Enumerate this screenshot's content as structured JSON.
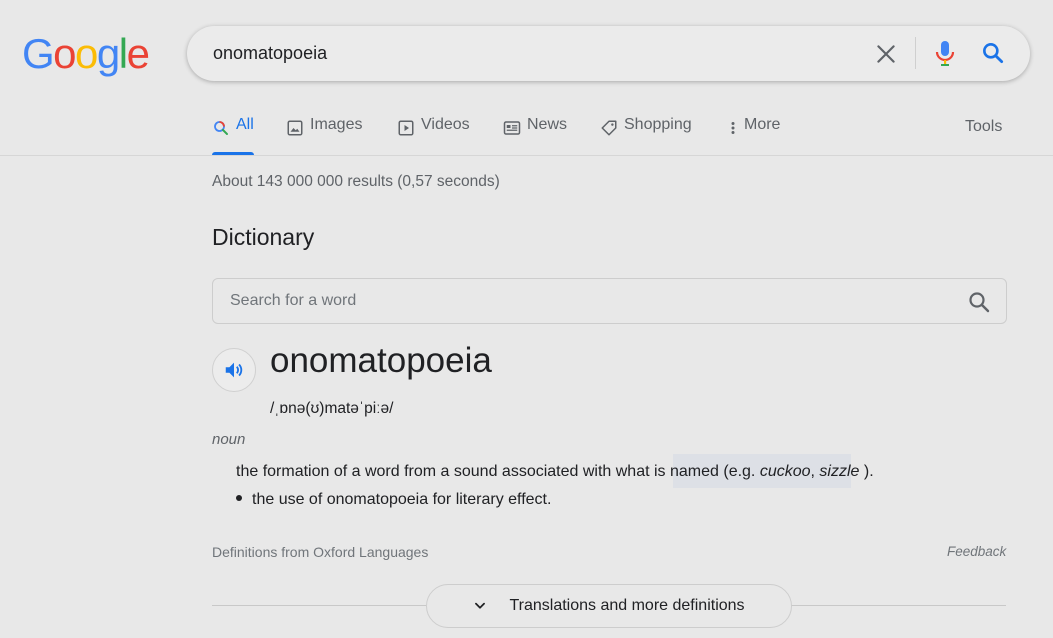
{
  "logo": {
    "letters": [
      "G",
      "o",
      "o",
      "g",
      "l",
      "e"
    ],
    "colors": [
      "#4285f4",
      "#ea4335",
      "#fbbc05",
      "#4285f4",
      "#34a853",
      "#ea4335"
    ]
  },
  "search": {
    "query": "onomatopoeia"
  },
  "tabs": [
    {
      "label": "All",
      "icon": "search-icon",
      "active": true
    },
    {
      "label": "Images",
      "icon": "image-icon"
    },
    {
      "label": "Videos",
      "icon": "play-icon"
    },
    {
      "label": "News",
      "icon": "newspaper-icon"
    },
    {
      "label": "Shopping",
      "icon": "tag-icon"
    },
    {
      "label": "More",
      "icon": "more-vert-icon"
    }
  ],
  "tools_label": "Tools",
  "result_stats": "About 143 000 000 results (0,57 seconds)",
  "dictionary": {
    "title": "Dictionary",
    "search_placeholder": "Search for a word",
    "headword": "onomatopoeia",
    "phonetic": "/ˌɒnə(ʊ)matəˈpiːə/",
    "part_of_speech": "noun",
    "definition_main_prefix": "the formation of a word from a sound associated with what is named (e.g. ",
    "example1": "cuckoo",
    "sep": ", ",
    "example2": "sizzle",
    "definition_main_suffix": " ).",
    "definition_sub": "the use of onomatopoeia for literary effect.",
    "source": "Definitions from Oxford Languages",
    "feedback": "Feedback",
    "more_button": "Translations and more definitions"
  },
  "colors": {
    "accent": "#1a73e8",
    "background": "#e8e8e8",
    "secondary_text": "#5f6368"
  }
}
